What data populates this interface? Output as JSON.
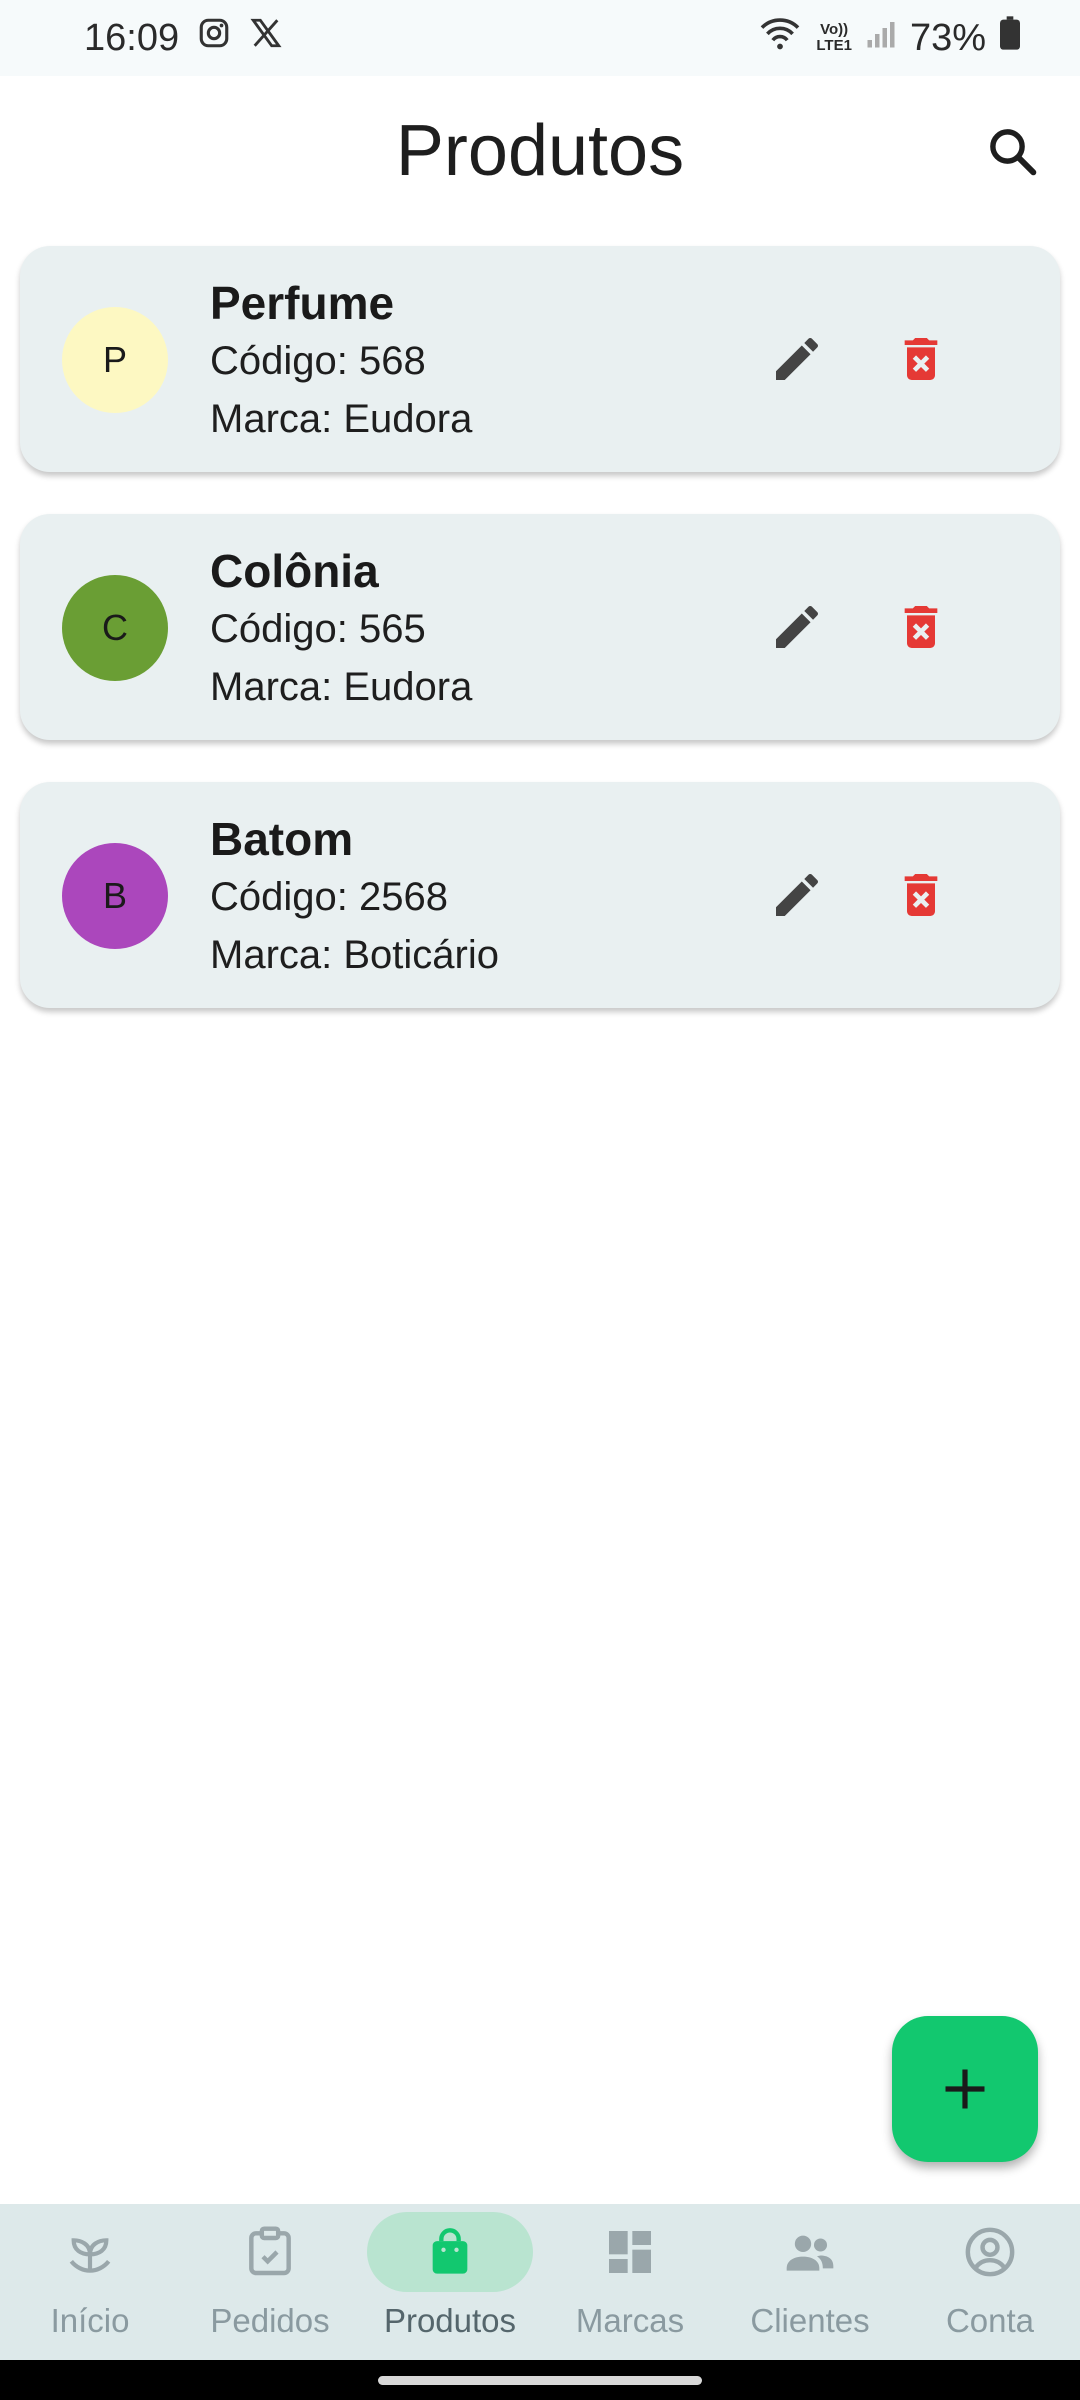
{
  "status": {
    "time": "16:09",
    "battery": "73%",
    "lte_top": "Vo))",
    "lte_bottom": "LTE1"
  },
  "app_bar": {
    "title": "Produtos"
  },
  "products": [
    {
      "initial": "P",
      "name": "Perfume",
      "code": "Código: 568",
      "brand": "Marca: Eudora",
      "avatar_color": "#fdf8c2"
    },
    {
      "initial": "C",
      "name": "Colônia",
      "code": "Código: 565",
      "brand": "Marca: Eudora",
      "avatar_color": "#6a9e34"
    },
    {
      "initial": "B",
      "name": "Batom",
      "code": "Código: 2568",
      "brand": "Marca: Boticário",
      "avatar_color": "#ab47bc"
    }
  ],
  "colors": {
    "accent": "#12c86f",
    "delete": "#e53935",
    "edit": "#444444"
  },
  "nav": [
    {
      "label": "Início",
      "icon": "sprout-icon"
    },
    {
      "label": "Pedidos",
      "icon": "clipboard-check-icon"
    },
    {
      "label": "Produtos",
      "icon": "shopping-bag-icon",
      "active": true
    },
    {
      "label": "Marcas",
      "icon": "dashboard-icon"
    },
    {
      "label": "Clientes",
      "icon": "people-icon"
    },
    {
      "label": "Conta",
      "icon": "account-circle-icon"
    }
  ]
}
